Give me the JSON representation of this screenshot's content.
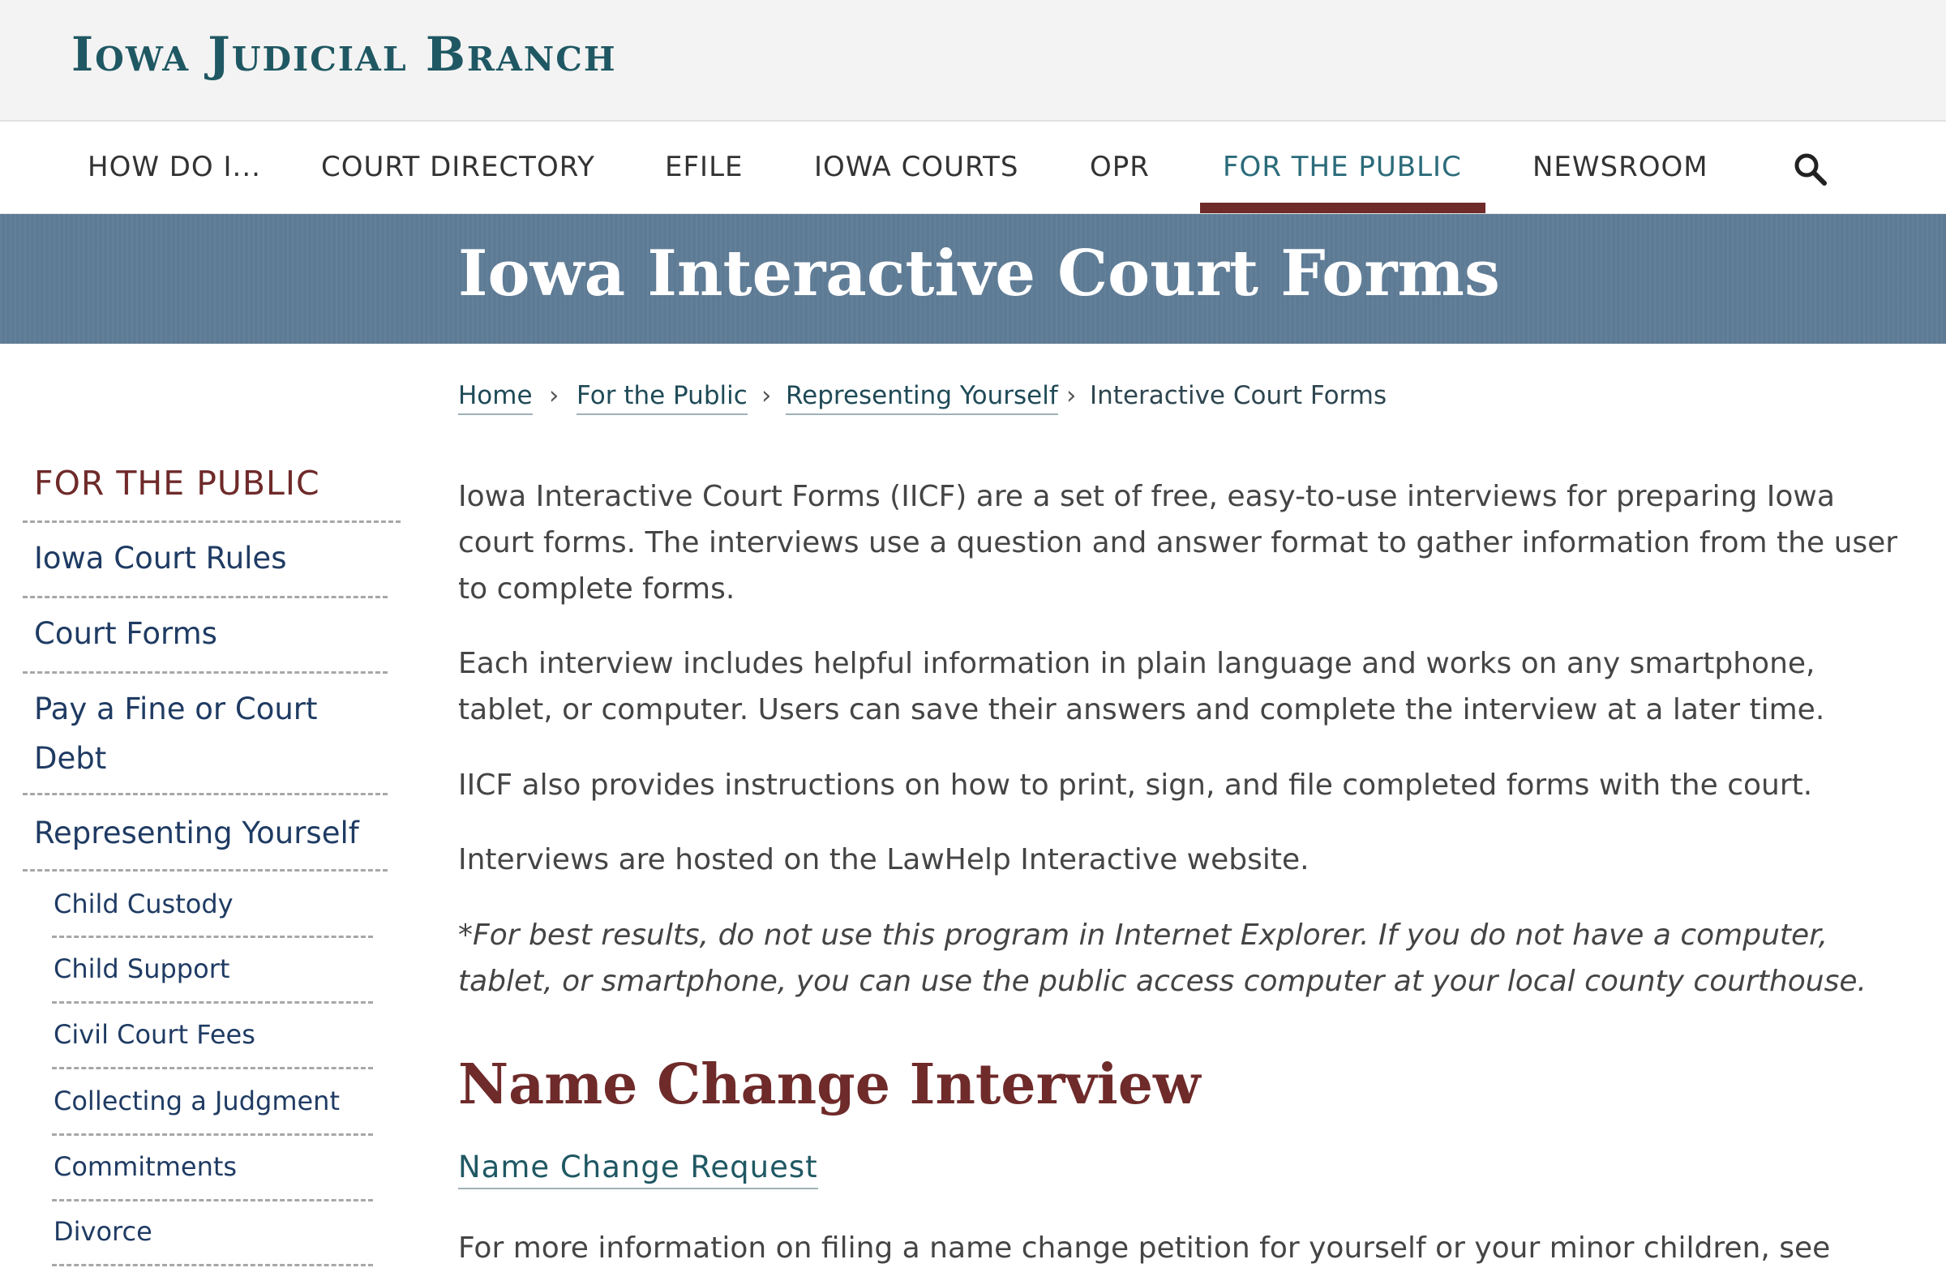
{
  "header": {
    "logo_text": "Iowa Judicial Branch"
  },
  "nav": {
    "items": [
      {
        "label": "HOW DO I..."
      },
      {
        "label": "COURT DIRECTORY"
      },
      {
        "label": "EFILE"
      },
      {
        "label": "IOWA COURTS"
      },
      {
        "label": "OPR"
      },
      {
        "label": "FOR THE PUBLIC"
      },
      {
        "label": "NEWSROOM"
      }
    ],
    "active_index": 5,
    "search_icon": "search-icon"
  },
  "banner": {
    "title": "Iowa Interactive Court Forms"
  },
  "breadcrumb": {
    "items": [
      "Home",
      "For the Public",
      "Representing Yourself"
    ],
    "separator": "›",
    "current": "Interactive Court Forms"
  },
  "sidebar": {
    "heading": "FOR THE PUBLIC",
    "links": [
      "Iowa Court Rules",
      "Court Forms",
      "Pay a Fine or Court Debt",
      "Representing Yourself"
    ],
    "sublinks": [
      "Child Custody",
      "Child Support",
      "Civil Court Fees",
      "Collecting a Judgment",
      "Commitments",
      "Divorce"
    ]
  },
  "main": {
    "paragraphs": [
      "Iowa Interactive Court Forms (IICF) are a set of free, easy-to-use interviews for preparing Iowa court forms. The interviews use a question and answer format to gather information from the user to complete forms.",
      "Each interview includes helpful information in plain language and works on any smartphone, tablet, or computer.  Users can save their answers and complete the interview at a later time.",
      "IICF also provides instructions on how to print, sign, and file completed forms with the court.",
      "Interviews are hosted on the LawHelp Interactive website."
    ],
    "note": "*For best results, do not use this program in Internet Explorer. If you do not have a computer, tablet, or smartphone, you can use the public access computer at your local county courthouse.",
    "section_heading": "Name Change Interview",
    "section_link": "Name Change Request",
    "section_text": "For more information on filing a name change petition for yourself or your minor children, see"
  },
  "colors": {
    "brand_teal": "#1f5863",
    "accent_maroon": "#6f2a2a",
    "banner_blue": "#5e7b95",
    "link_navy": "#1f3b63"
  }
}
